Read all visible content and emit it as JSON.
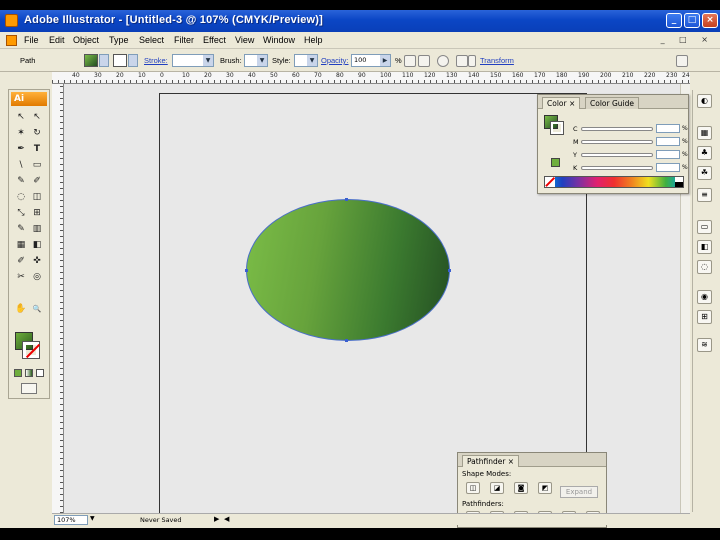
{
  "window": {
    "title": "Adobe Illustrator - [Untitled-3 @ 107% (CMYK/Preview)]",
    "minimize": "_",
    "maximize": "□",
    "close": "×"
  },
  "menu": [
    "File",
    "Edit",
    "Object",
    "Type",
    "Select",
    "Filter",
    "Effect",
    "View",
    "Window",
    "Help"
  ],
  "mdi_buttons": "_ □ ×",
  "controlbar": {
    "selection_label": "Path",
    "stroke_label": "Stroke:",
    "brush_label": "Brush:",
    "style_label": "Style:",
    "opacity_label": "Opacity:",
    "opacity_value": "100",
    "opacity_unit": "%",
    "transform_label": "Transform"
  },
  "ruler": {
    "ticks": [
      "40",
      "30",
      "20",
      "10",
      "0",
      "10",
      "20",
      "30",
      "40",
      "50",
      "60",
      "70",
      "80",
      "90",
      "100",
      "110",
      "120",
      "130",
      "140",
      "150",
      "160",
      "170",
      "180",
      "190",
      "200",
      "210",
      "220",
      "230",
      "24"
    ]
  },
  "tools": {
    "badge": "Ai",
    "glyphs": [
      "↖",
      "↖",
      "✶",
      "↻",
      "✒",
      "T",
      "\\",
      "▭",
      "✎",
      "✐",
      "◌",
      "◫",
      "⤡",
      "⊞",
      "✎",
      "▥",
      "▦",
      "◧",
      "✐",
      "✜",
      "✂",
      "◎",
      "✋",
      "🔍"
    ]
  },
  "color_panel": {
    "tabs": [
      "Color",
      "Color Guide"
    ],
    "channels": [
      {
        "label": "C",
        "value": ""
      },
      {
        "label": "M",
        "value": ""
      },
      {
        "label": "Y",
        "value": ""
      },
      {
        "label": "K",
        "value": ""
      }
    ],
    "unit": "%"
  },
  "pathfinder_panel": {
    "tab": "Pathfinder",
    "shape_modes_label": "Shape Modes:",
    "pathfinders_label": "Pathfinders:",
    "expand_label": "Expand"
  },
  "status": {
    "zoom": "107%",
    "saved": "Never Saved"
  },
  "colors": {
    "fill_gradient_start": "#7bbd47",
    "fill_gradient_end": "#244e22",
    "selection": "#3a5fd0",
    "titlebar": "#0b46c5"
  }
}
